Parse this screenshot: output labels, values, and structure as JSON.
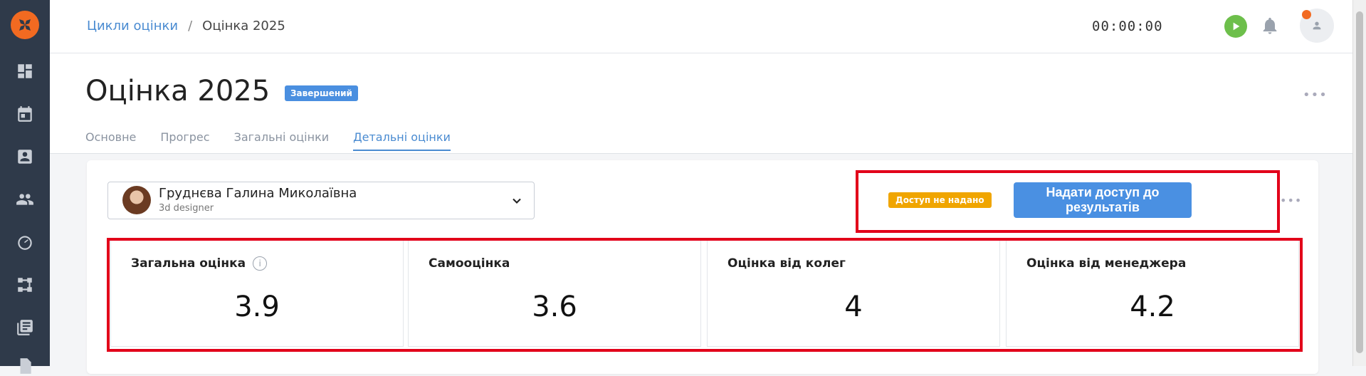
{
  "breadcrumb": {
    "parent": "Цикли оцінки",
    "separator": "/",
    "current": "Оцінка 2025"
  },
  "timer": "00:00:00",
  "page": {
    "title": "Оцінка 2025",
    "status": "Завершений",
    "tabs": [
      "Основне",
      "Прогрес",
      "Загальні оцінки",
      "Детальні оцінки"
    ],
    "active_tab": "Детальні оцінки"
  },
  "employee": {
    "name": "Груднєва Галина Миколаївна",
    "role": "3d designer"
  },
  "access": {
    "badge": "Доступ не надано",
    "button": "Надати доступ до результатів"
  },
  "scores": [
    {
      "label": "Загальна оцінка",
      "value": "3.9",
      "info": true
    },
    {
      "label": "Самооцінка",
      "value": "3.6"
    },
    {
      "label": "Оцінка від колег",
      "value": "4"
    },
    {
      "label": "Оцінка від менеджера",
      "value": "4.2"
    }
  ],
  "colors": {
    "brand_orange": "#f26a21",
    "sidebar": "#2f3a4a",
    "accent_blue": "#4a90e2",
    "status_badge": "#4a8fe0",
    "access_badge": "#f0a500",
    "highlight_red": "#e2001a"
  },
  "icons": {
    "sidebar": [
      "dashboard-icon",
      "calendar-icon",
      "contact-card-icon",
      "people-icon",
      "gauge-icon",
      "workflow-icon",
      "library-icon"
    ]
  }
}
